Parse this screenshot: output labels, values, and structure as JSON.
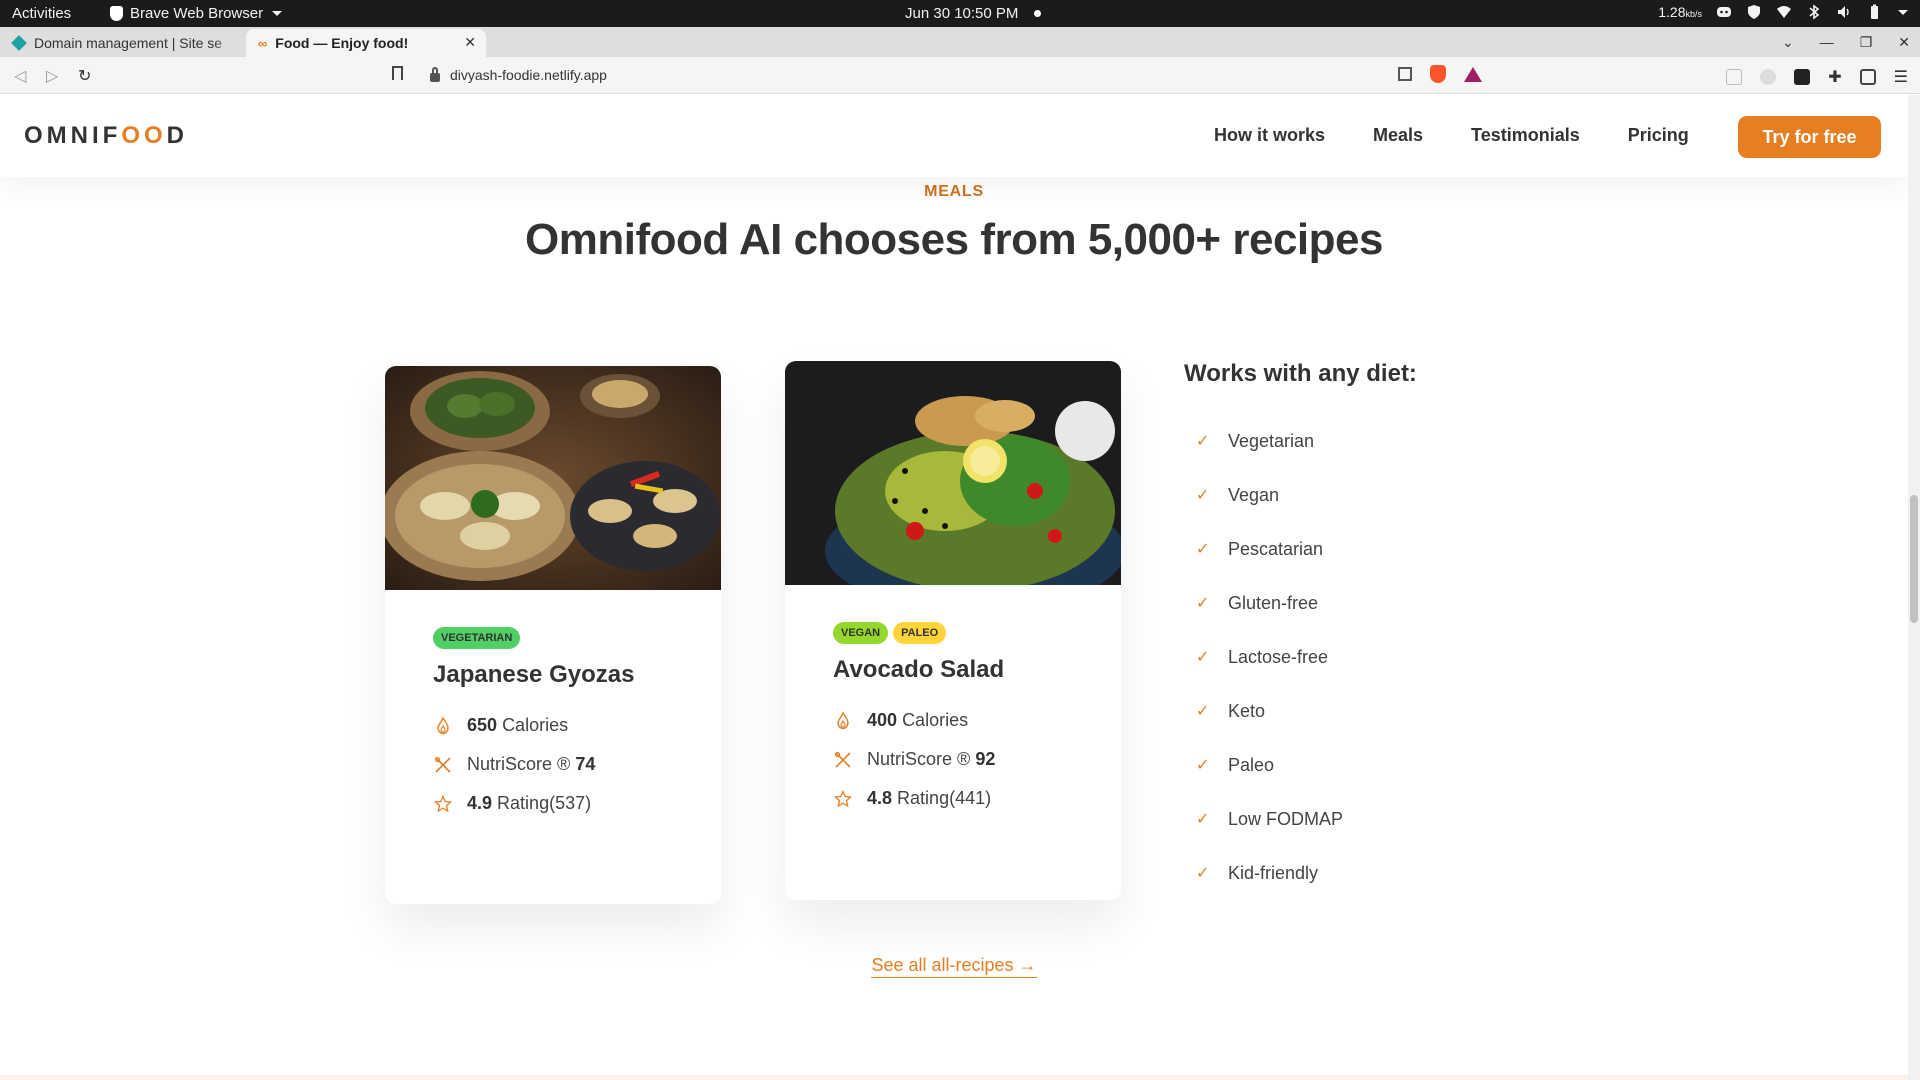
{
  "system_bar": {
    "activities": "Activities",
    "app_name": "Brave Web Browser",
    "datetime": "Jun 30  10:50 PM",
    "net_speed": "1.28",
    "net_unit": "kb/s"
  },
  "browser": {
    "tabs": [
      {
        "label": "Domain management | Site se",
        "active": false
      },
      {
        "label": "Food — Enjoy food!",
        "active": true
      }
    ],
    "url": "divyash-foodie.netlify.app"
  },
  "site": {
    "logo_left": "OMNIF",
    "logo_oo": "OO",
    "logo_right": "D",
    "nav": [
      "How it works",
      "Meals",
      "Testimonials",
      "Pricing"
    ],
    "cta": "Try for free",
    "subheading": "MEALS",
    "heading": "Omnifood AI chooses from 5,000+ recipes",
    "meals": [
      {
        "tags": [
          "VEGETARIAN"
        ],
        "title": "Japanese Gyozas",
        "calories_value": "650",
        "calories_label": "Calories",
        "nutri_label": "NutriScore ®",
        "nutri_value": "74",
        "rating_value": "4.9",
        "rating_label": "Rating(537)"
      },
      {
        "tags": [
          "VEGAN",
          "PALEO"
        ],
        "title": "Avocado Salad",
        "calories_value": "400",
        "calories_label": "Calories",
        "nutri_label": "NutriScore ®",
        "nutri_value": "92",
        "rating_value": "4.8",
        "rating_label": "Rating(441)"
      }
    ],
    "diets_title": "Works with any diet:",
    "diets": [
      "Vegetarian",
      "Vegan",
      "Pescatarian",
      "Gluten-free",
      "Lactose-free",
      "Keto",
      "Paleo",
      "Low FODMAP",
      "Kid-friendly"
    ],
    "all_recipes_link": "See all all-recipes →"
  },
  "colors": {
    "brand": "#e67e22",
    "tag_vegetarian": "#51cf66",
    "tag_vegan": "#94d82d",
    "tag_paleo": "#ffd43b"
  }
}
